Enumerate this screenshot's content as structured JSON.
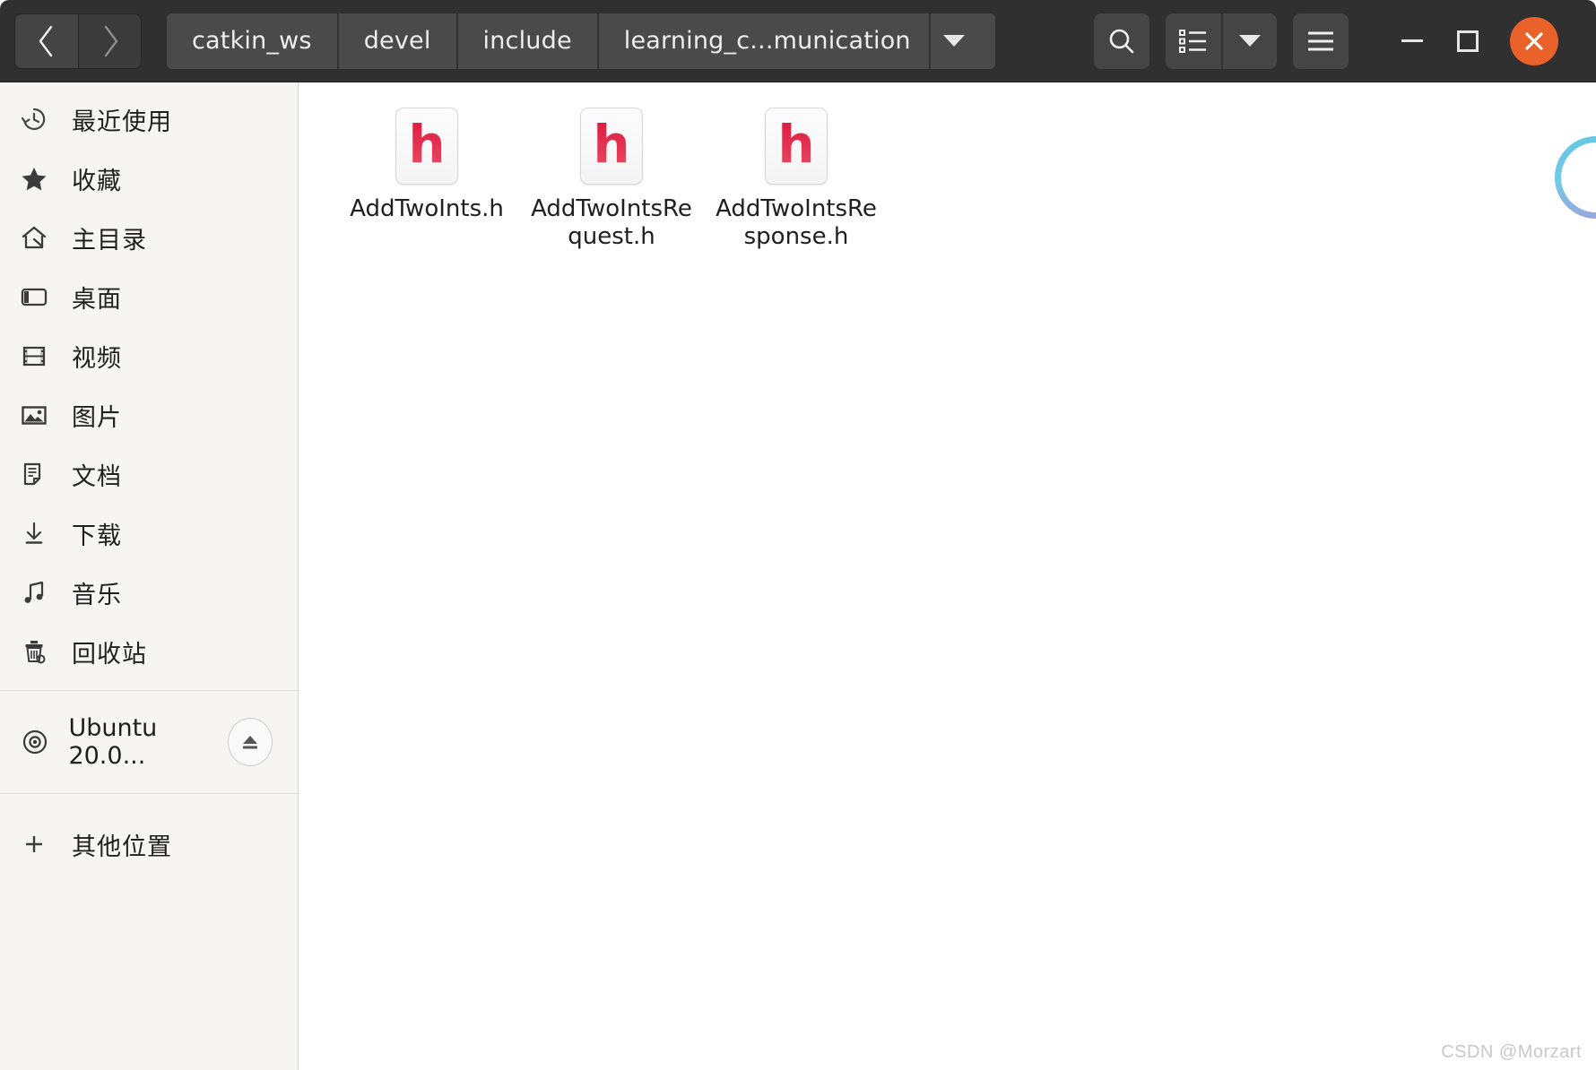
{
  "window": {
    "close_color": "#e8622a",
    "header_bg": "#303030"
  },
  "nav": {
    "back_label": "Back",
    "forward_label": "Forward",
    "back_icon": "chevron-left-icon",
    "forward_icon": "chevron-right-icon"
  },
  "breadcrumb": {
    "items": [
      {
        "label": "catkin_ws"
      },
      {
        "label": "devel"
      },
      {
        "label": "include"
      },
      {
        "label": "learning_c...munication"
      }
    ],
    "dropdown_icon": "chevron-down-icon"
  },
  "toolbar": {
    "search_label": "Search",
    "search_icon": "search-icon",
    "view_list_label": "List view",
    "view_list_icon": "list-view-icon",
    "view_options_label": "View options",
    "view_options_icon": "chevron-down-icon",
    "menu_label": "Main menu",
    "menu_icon": "hamburger-menu-icon"
  },
  "window_controls": {
    "minimize_label": "Minimize",
    "maximize_label": "Maximize",
    "close_label": "Close",
    "minimize_icon": "minimize-icon",
    "maximize_icon": "maximize-icon",
    "close_icon": "close-icon"
  },
  "sidebar": {
    "items": [
      {
        "label": "最近使用",
        "icon": "recent-clock-icon",
        "name": "recent"
      },
      {
        "label": "收藏",
        "icon": "star-icon",
        "name": "starred"
      },
      {
        "label": "主目录",
        "icon": "home-icon",
        "name": "home"
      },
      {
        "label": "桌面",
        "icon": "desktop-icon",
        "name": "desktop"
      },
      {
        "label": "视频",
        "icon": "video-film-icon",
        "name": "videos"
      },
      {
        "label": "图片",
        "icon": "image-picture-icon",
        "name": "pictures"
      },
      {
        "label": "文档",
        "icon": "document-icon",
        "name": "documents"
      },
      {
        "label": "下载",
        "icon": "download-arrow-icon",
        "name": "downloads"
      },
      {
        "label": "音乐",
        "icon": "music-note-icon",
        "name": "music"
      },
      {
        "label": "回收站",
        "icon": "trash-bin-icon",
        "name": "trash"
      }
    ],
    "device": {
      "label": "Ubuntu 20.0...",
      "icon": "disc-icon",
      "eject_icon": "eject-icon",
      "eject_label": "Eject"
    },
    "other_locations": {
      "label": "其他位置",
      "icon": "plus-icon"
    }
  },
  "content": {
    "files": [
      {
        "name": "AddTwoInts.h",
        "icon": "h-header-file-icon",
        "glyph": "h"
      },
      {
        "name": "AddTwoIntsRequest.h",
        "icon": "h-header-file-icon",
        "glyph": "h"
      },
      {
        "name": "AddTwoIntsResponse.h",
        "icon": "h-header-file-icon",
        "glyph": "h"
      }
    ]
  },
  "watermark": {
    "text": "CSDN @Morzart"
  }
}
